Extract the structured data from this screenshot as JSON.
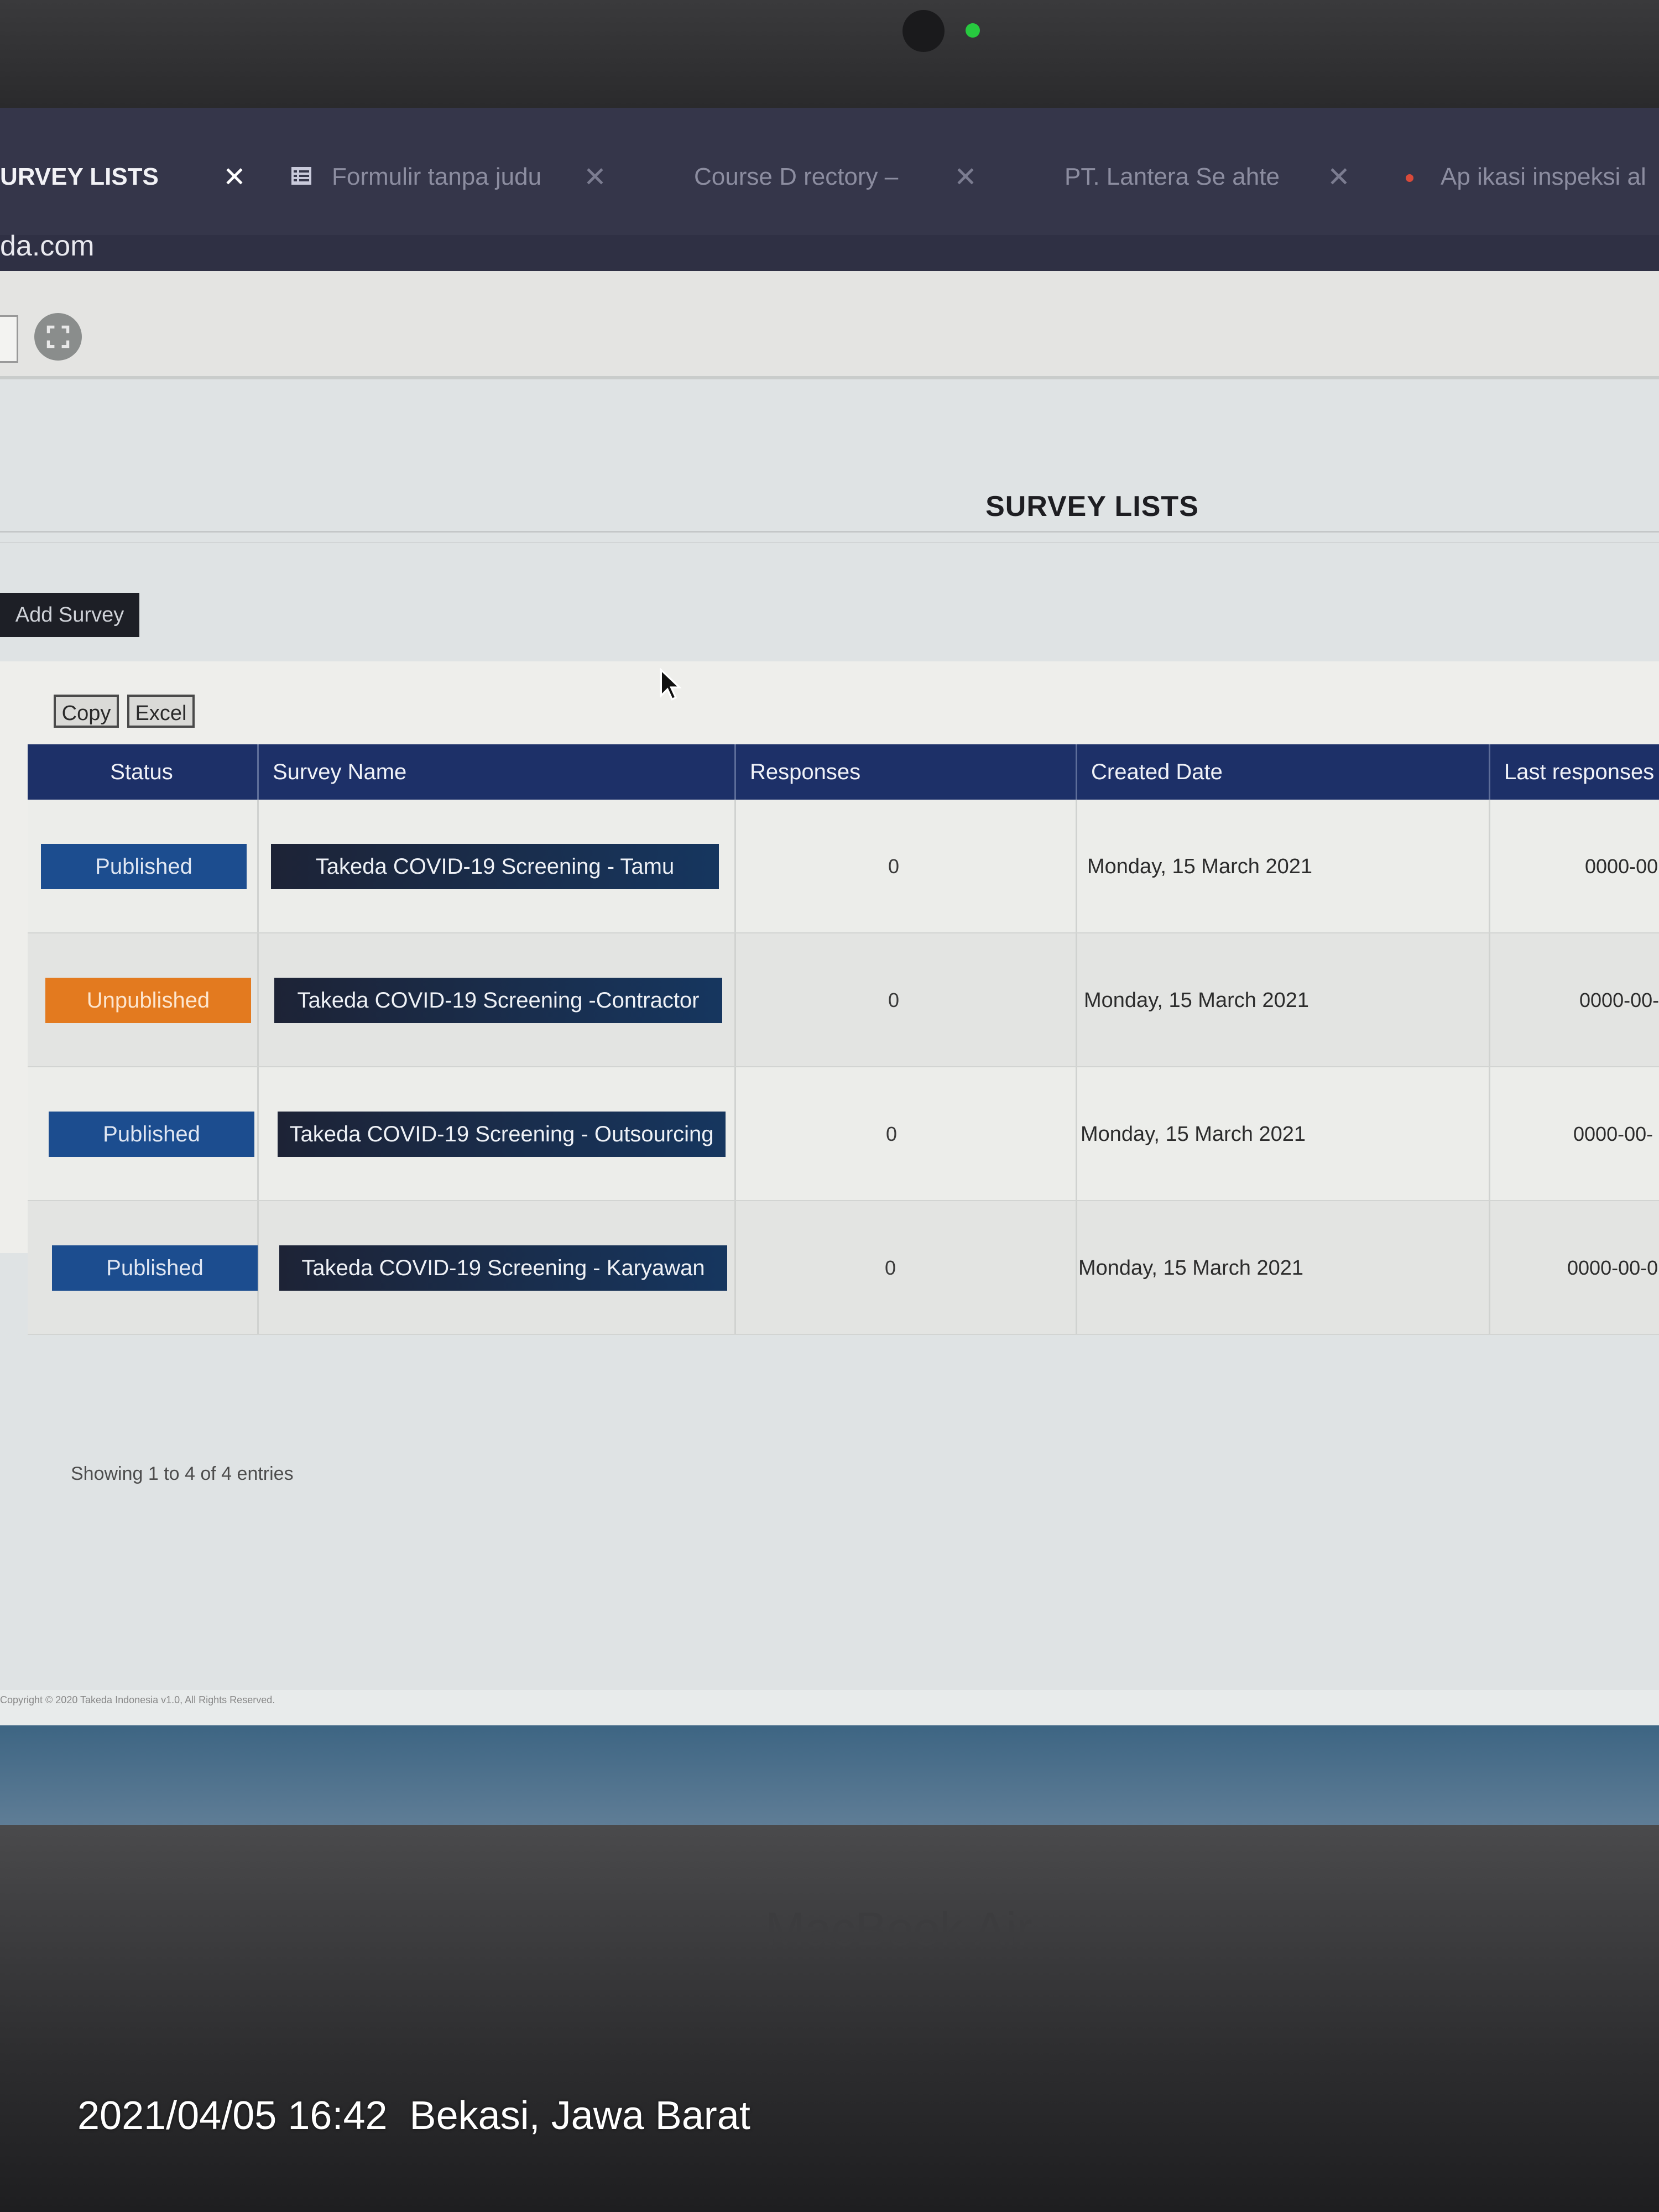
{
  "browser": {
    "tabs": [
      {
        "title": "URVEY LISTS",
        "active": true
      },
      {
        "title": "Formulir tanpa judu",
        "active": false
      },
      {
        "title": "Course D rectory –",
        "active": false
      },
      {
        "title": "PT. Lantera Se ahte",
        "active": false
      },
      {
        "title": "Ap ikasi inspeksi al",
        "active": false
      }
    ],
    "close_glyph": "✕",
    "url": "da.com"
  },
  "page": {
    "title": "SURVEY LISTS",
    "add_survey_label": "Add Survey",
    "export_buttons": {
      "copy": "Copy",
      "excel": "Excel"
    },
    "table": {
      "headers": [
        "Status",
        "Survey Name",
        "Responses",
        "Created Date",
        "Last responses"
      ],
      "rows": [
        {
          "status": "Published",
          "name": "Takeda COVID-19 Screening - Tamu",
          "responses": "0",
          "created": "Monday, 15 March 2021",
          "last": "0000-00"
        },
        {
          "status": "Unpublished",
          "name": "Takeda COVID-19 Screening -Contractor",
          "responses": "0",
          "created": "Monday, 15 March 2021",
          "last": "0000-00-"
        },
        {
          "status": "Published",
          "name": "Takeda COVID-19 Screening - Outsourcing",
          "responses": "0",
          "created": "Monday, 15 March 2021",
          "last": "0000-00-"
        },
        {
          "status": "Published",
          "name": "Takeda COVID-19 Screening - Karyawan",
          "responses": "0",
          "created": "Monday, 15 March 2021",
          "last": "0000-00-0"
        }
      ]
    },
    "info": "Showing 1 to 4 of 4 entries",
    "copyright": "Copyright © 2020 Takeda Indonesia v1.0, All Rights Reserved."
  },
  "device": {
    "label": "MacBook Air",
    "photo_stamp": "2021/04/05 16:42  Bekasi, Jawa Barat"
  },
  "colors": {
    "header": "#1d3068",
    "published": "#1c4d8f",
    "unpublished": "#e37a1f"
  }
}
